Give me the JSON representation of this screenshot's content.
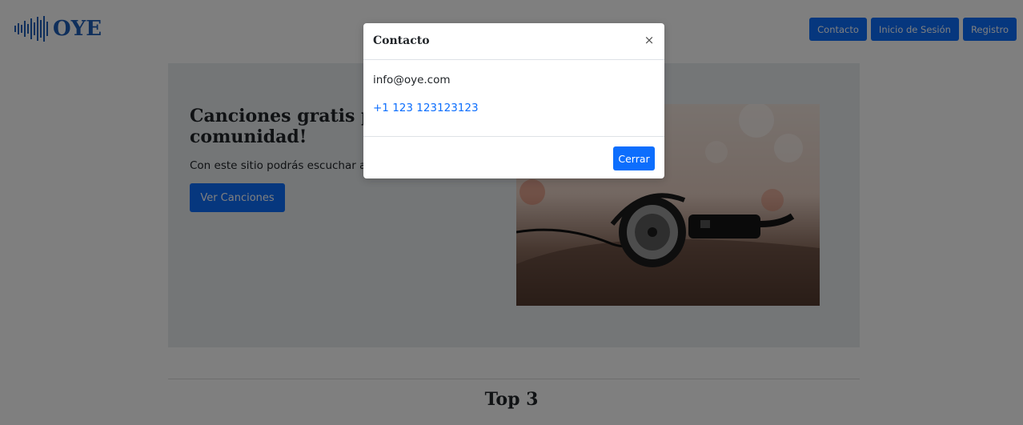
{
  "brand": {
    "name": "OYE"
  },
  "nav": {
    "contact_label": "Contacto",
    "login_label": "Inicio de Sesión",
    "register_label": "Registro"
  },
  "hero": {
    "title": "Canciones gratis pa",
    "title_line2": "comunidad!",
    "lead": "Con este sitio podrás escuchar au",
    "button_label": "Ver Canciones",
    "image_icon": "headphones-image"
  },
  "section": {
    "title": "Top 3"
  },
  "modal": {
    "title": "Contacto",
    "close_symbol": "×",
    "email": "info@oye.com",
    "phone": "+1 123 123123123",
    "close_button_label": "Cerrar"
  },
  "colors": {
    "primary": "#0d6efd",
    "brand": "#1e5fb8"
  }
}
